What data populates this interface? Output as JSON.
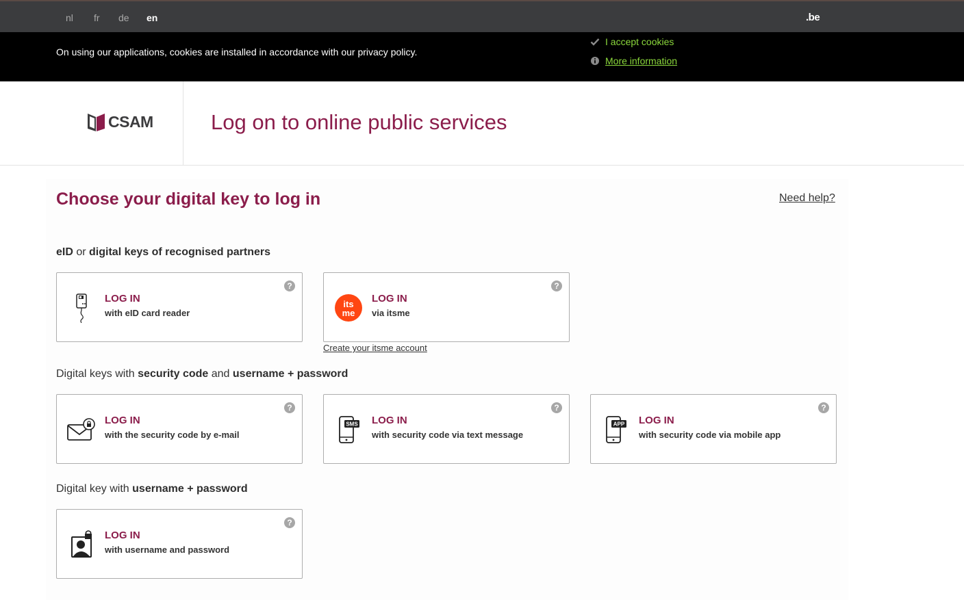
{
  "languages": [
    {
      "code": "nl",
      "active": false
    },
    {
      "code": "fr",
      "active": false
    },
    {
      "code": "de",
      "active": false
    },
    {
      "code": "en",
      "active": true
    }
  ],
  "topbar": {
    "be_logo": ".be"
  },
  "cookie": {
    "text": "On using our applications, cookies are installed in accordance with our privacy policy.",
    "accept": "I accept cookies",
    "more": "More information"
  },
  "header": {
    "logo_text": "CSAM",
    "title": "Log on to online public services"
  },
  "main": {
    "title": "Choose your digital key to log in",
    "help": "Need help?"
  },
  "groups": [
    {
      "parts": [
        {
          "text": "eID",
          "bold": true
        },
        {
          "text": " or ",
          "bold": false
        },
        {
          "text": "digital keys of recognised partners",
          "bold": true
        }
      ]
    },
    {
      "parts": [
        {
          "text": "Digital keys with ",
          "bold": false
        },
        {
          "text": "security code",
          "bold": true
        },
        {
          "text": " and ",
          "bold": false
        },
        {
          "text": "username + password",
          "bold": true
        }
      ]
    },
    {
      "parts": [
        {
          "text": "Digital key with ",
          "bold": false
        },
        {
          "text": "username + password",
          "bold": true
        }
      ]
    }
  ],
  "cards": [
    {
      "icon": "eid-card-reader-icon",
      "title": "LOG IN",
      "subtitle": "with eID card reader"
    },
    {
      "icon": "itsme-logo-icon",
      "title": "LOG IN",
      "subtitle": "via itsme"
    },
    {
      "icon": "email-lock-icon",
      "title": "LOG IN",
      "subtitle": "with the security code by e-mail"
    },
    {
      "icon": "sms-phone-icon",
      "title": "LOG IN",
      "subtitle": "with security code via text message",
      "badge": "SMS"
    },
    {
      "icon": "app-phone-icon",
      "title": "LOG IN",
      "subtitle": "with security code via mobile app",
      "badge": "APP"
    },
    {
      "icon": "user-lock-icon",
      "title": "LOG IN",
      "subtitle": "with username and password"
    }
  ],
  "itsme_link": "Create your itsme account",
  "colors": {
    "brand": "#8b1d4b",
    "cookie_green": "#8bd83c",
    "topbar": "#3b3c3e"
  }
}
